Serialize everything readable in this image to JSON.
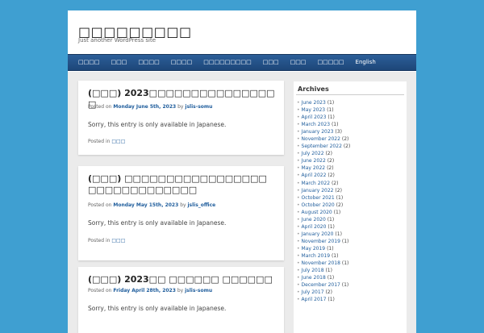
{
  "site": {
    "title": "□□□□□□□□□",
    "description": "Just another WordPress site"
  },
  "nav": {
    "items": [
      "□□□□",
      "□□□",
      "□□□□",
      "□□□□",
      "□□□□□□□□□",
      "□□□",
      "□□□",
      "□□□□□",
      "English"
    ]
  },
  "posts": [
    {
      "title": "(□□□) 2023□□□□□□□□□□□□□□□□",
      "meta_prefix": "Posted on",
      "date": "Monday June 5th, 2023",
      "meta_by": "by",
      "author": "jslis-somu",
      "body": "Sorry, this entry is only available in Japanese.",
      "posted_in": "Posted in",
      "category": "□□□"
    },
    {
      "title": "(□□□) □□□□□□□□□□□□□□□□□□□□□□□□□□□□□□",
      "meta_prefix": "Posted on",
      "date": "Monday May 15th, 2023",
      "meta_by": "by",
      "author": "jslis_office",
      "body": "Sorry, this entry is only available in Japanese.",
      "posted_in": "Posted in",
      "category": "□□□"
    },
    {
      "title": "(□□□) 2023□□ □□□□□□ □□□□□□",
      "meta_prefix": "Posted on",
      "date": "Friday April 28th, 2023",
      "meta_by": "by",
      "author": "jslis-somu",
      "body": "Sorry, this entry is only available in Japanese."
    }
  ],
  "sidebar": {
    "archives_title": "Archives",
    "archives": [
      {
        "month": "June 2023",
        "count": "(1)"
      },
      {
        "month": "May 2023",
        "count": "(1)"
      },
      {
        "month": "April 2023",
        "count": "(1)"
      },
      {
        "month": "March 2023",
        "count": "(1)"
      },
      {
        "month": "January 2023",
        "count": "(3)"
      },
      {
        "month": "November 2022",
        "count": "(2)"
      },
      {
        "month": "September 2022",
        "count": "(2)"
      },
      {
        "month": "July 2022",
        "count": "(2)"
      },
      {
        "month": "June 2022",
        "count": "(2)"
      },
      {
        "month": "May 2022",
        "count": "(2)"
      },
      {
        "month": "April 2022",
        "count": "(2)"
      },
      {
        "month": "March 2022",
        "count": "(2)"
      },
      {
        "month": "January 2022",
        "count": "(2)"
      },
      {
        "month": "October 2021",
        "count": "(1)"
      },
      {
        "month": "October 2020",
        "count": "(2)"
      },
      {
        "month": "August 2020",
        "count": "(1)"
      },
      {
        "month": "June 2020",
        "count": "(1)"
      },
      {
        "month": "April 2020",
        "count": "(1)"
      },
      {
        "month": "January 2020",
        "count": "(1)"
      },
      {
        "month": "November 2019",
        "count": "(1)"
      },
      {
        "month": "May 2019",
        "count": "(1)"
      },
      {
        "month": "March 2019",
        "count": "(1)"
      },
      {
        "month": "November 2018",
        "count": "(1)"
      },
      {
        "month": "July 2018",
        "count": "(1)"
      },
      {
        "month": "June 2018",
        "count": "(1)"
      },
      {
        "month": "December 2017",
        "count": "(1)"
      },
      {
        "month": "July 2017",
        "count": "(2)"
      },
      {
        "month": "April 2017",
        "count": "(1)"
      }
    ]
  }
}
